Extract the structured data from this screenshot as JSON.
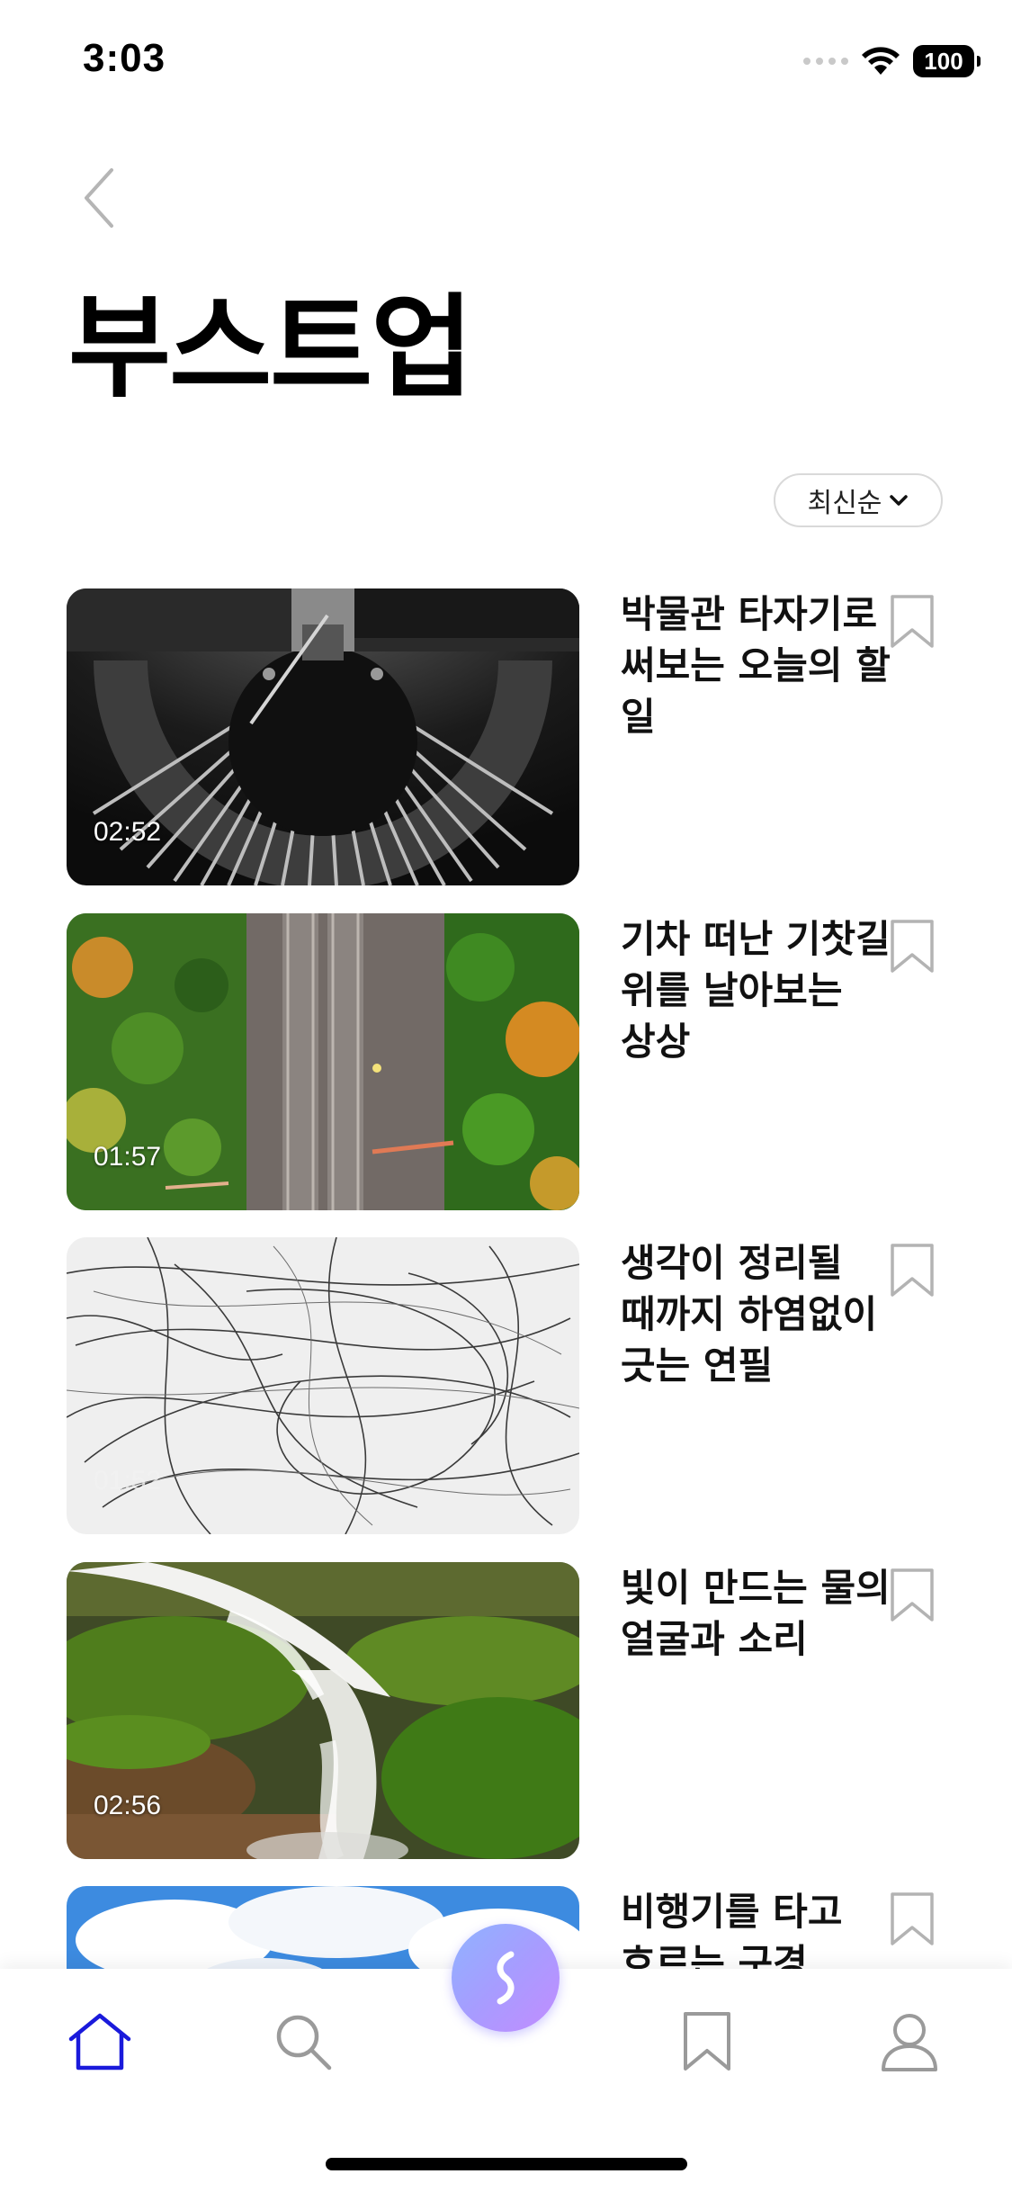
{
  "status_bar": {
    "time": "3:03",
    "battery": "100"
  },
  "header": {
    "back_icon": "chevron-left-icon",
    "title": "부스트업"
  },
  "sort": {
    "label": "최신순",
    "icon": "chevron-down-icon"
  },
  "videos": [
    {
      "title": "박물관 타자기로 써보는 오늘의 할 일",
      "duration": "02:52",
      "thumbnail": "typewriter",
      "bookmarked": false
    },
    {
      "title": "기차 떠난 기찻길 위를 날아보는 상상",
      "duration": "01:57",
      "thumbnail": "railway-aerial",
      "bookmarked": false
    },
    {
      "title": "생각이 정리될 때까지 하염없이 긋는 연필",
      "duration": "01:52",
      "thumbnail": "pencil-sketch",
      "bookmarked": false
    },
    {
      "title": "빛이 만드는 물의 얼굴과 소리",
      "duration": "02:56",
      "thumbnail": "waterfall",
      "bookmarked": false
    },
    {
      "title": "비행기를 타고 흐르는 구경",
      "duration": "",
      "thumbnail": "sky-clouds",
      "bookmarked": false
    }
  ],
  "bottom_nav": {
    "items": [
      "home-icon",
      "search-icon",
      "center-logo",
      "bookmark-icon",
      "profile-icon"
    ],
    "active": "home-icon"
  },
  "colors": {
    "accent": "#1a1adb",
    "inactive": "#9a9a9a",
    "center_gradient": [
      "#8fb3ff",
      "#c28cff"
    ]
  }
}
